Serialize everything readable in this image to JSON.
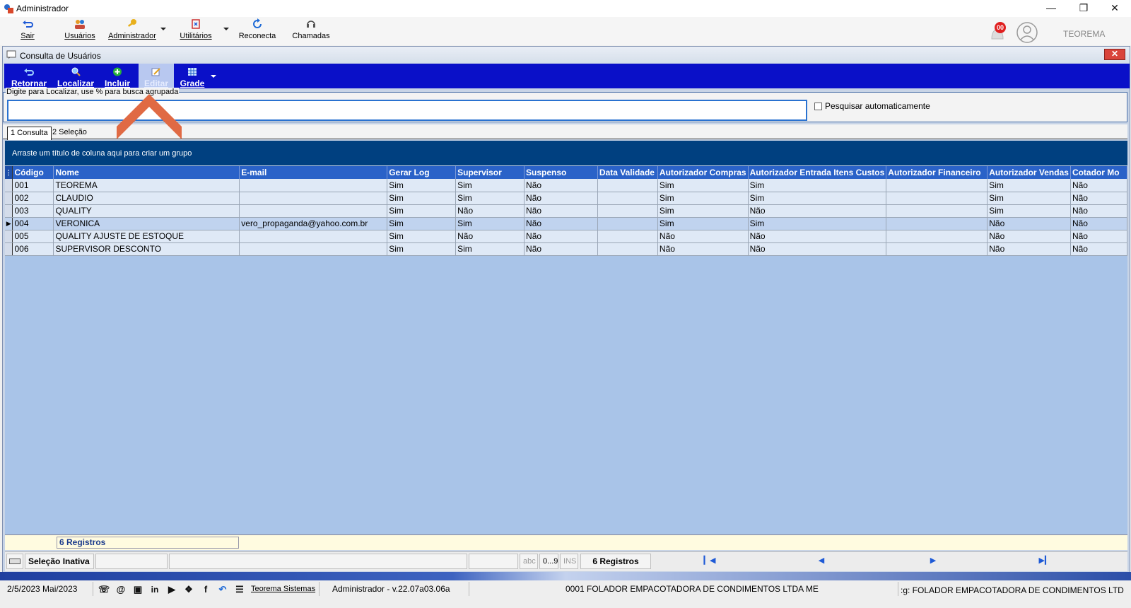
{
  "window": {
    "title": "Administrador"
  },
  "main_toolbar": {
    "items": [
      {
        "label": "Sair",
        "icon": "exit-arrow-icon"
      },
      {
        "label": "Usuários",
        "icon": "users-icon"
      },
      {
        "label": "Administrador",
        "icon": "key-icon"
      },
      {
        "label": "Utilitários",
        "icon": "tools-icon"
      },
      {
        "label": "Reconecta",
        "icon": "refresh-icon"
      },
      {
        "label": "Chamadas",
        "icon": "support-icon"
      }
    ],
    "notification_count": "00",
    "user_name": "TEOREMA"
  },
  "child_window": {
    "title": "Consulta de Usuários"
  },
  "child_toolbar": {
    "items": [
      {
        "label": "Retornar",
        "icon": "back-icon"
      },
      {
        "label": "Localizar",
        "icon": "search-icon"
      },
      {
        "label": "Incluir",
        "icon": "add-icon"
      },
      {
        "label": "Editar",
        "icon": "edit-icon"
      },
      {
        "label": "Grade",
        "icon": "grid-icon"
      }
    ]
  },
  "search": {
    "legend": "Digite para Localizar, use % para busca agrupada",
    "value": "",
    "auto_search_label": "Pesquisar automaticamente",
    "auto_search_checked": false
  },
  "tabs": [
    {
      "label": "1 Consulta",
      "active": true
    },
    {
      "label": "2 Seleção",
      "active": false
    }
  ],
  "group_panel_text": "Arraste um título de coluna aqui para criar um grupo",
  "grid": {
    "columns": [
      "Código",
      "Nome",
      "E-mail",
      "Gerar Log",
      "Supervisor",
      "Suspenso",
      "Data Validade",
      "Autorizador Compras",
      "Autorizador Entrada Itens Custos",
      "Autorizador Financeiro",
      "Autorizador Vendas",
      "Cotador Mo"
    ],
    "rows": [
      [
        "001",
        "TEOREMA",
        "",
        "Sim",
        "Sim",
        "Não",
        "",
        "Sim",
        "Sim",
        "",
        "Sim",
        "Não"
      ],
      [
        "002",
        "CLAUDIO",
        "",
        "Sim",
        "Sim",
        "Não",
        "",
        "Sim",
        "Sim",
        "",
        "Sim",
        "Não"
      ],
      [
        "003",
        "QUALITY",
        "",
        "Sim",
        "Não",
        "Não",
        "",
        "Sim",
        "Não",
        "",
        "Sim",
        "Não"
      ],
      [
        "004",
        "VERONICA",
        "vero_propaganda@yahoo.com.br",
        "Sim",
        "Sim",
        "Não",
        "",
        "Sim",
        "Sim",
        "",
        "Não",
        "Não"
      ],
      [
        "005",
        "QUALITY AJUSTE DE ESTOQUE",
        "",
        "Sim",
        "Não",
        "Não",
        "",
        "Não",
        "Não",
        "",
        "Não",
        "Não"
      ],
      [
        "006",
        "SUPERVISOR DESCONTO",
        "",
        "Sim",
        "Sim",
        "Não",
        "",
        "Não",
        "Não",
        "",
        "Não",
        "Não"
      ]
    ],
    "selected_row": 3
  },
  "footer": {
    "count": "6 Registros"
  },
  "status": {
    "selection": "Seleção Inativa",
    "abc": "abc",
    "num": "0...9",
    "ins": "INS",
    "records": "6 Registros"
  },
  "bottom": {
    "date": "2/5/2023 Mai/2023",
    "link": "Teorema Sistemas",
    "user_version": "Administrador - v.22.07a03.06a",
    "company": "0001 FOLADOR EMPACOTADORA DE CONDIMENTOS LTDA ME",
    "company_right": ":g: FOLADOR EMPACOTADORA DE CONDIMENTOS LTD"
  },
  "colors": {
    "toolbar_blue": "#0a10c8",
    "grid_header": "#2a62c8",
    "group_panel": "#004080",
    "arrow": "#e06a44"
  }
}
